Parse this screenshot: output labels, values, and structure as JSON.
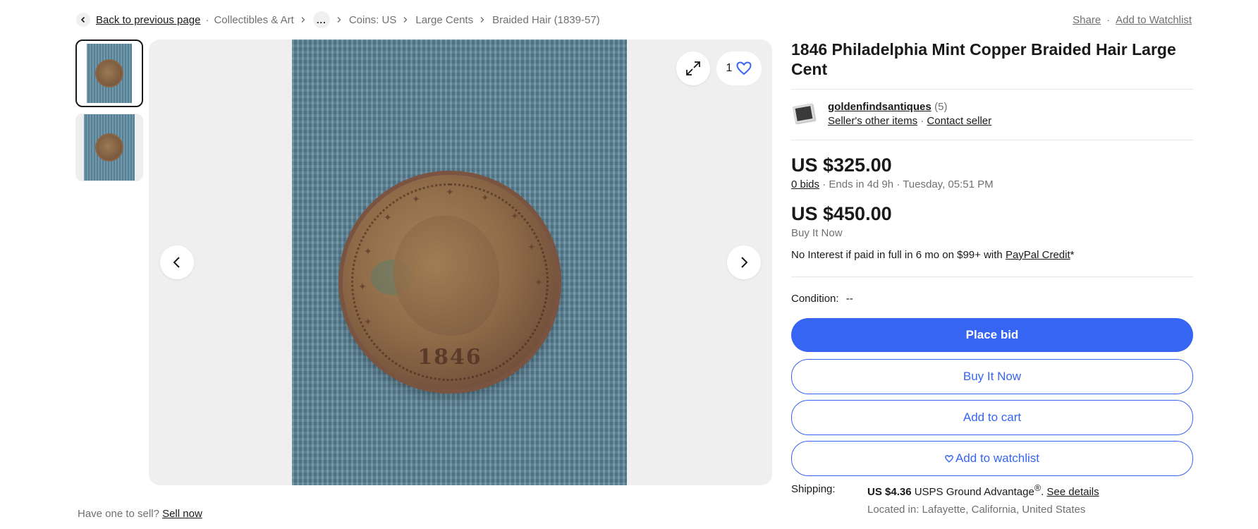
{
  "breadcrumb": {
    "back_label": "Back to previous page",
    "items": [
      "Collectibles & Art",
      "Coins: US",
      "Large Cents",
      "Braided Hair (1839-57)"
    ],
    "more": "..."
  },
  "actions": {
    "share": "Share",
    "watchlist": "Add to Watchlist"
  },
  "gallery": {
    "favorite_count": "1",
    "coin_year": "1846"
  },
  "sell": {
    "prompt": "Have one to sell?",
    "link": "Sell now"
  },
  "listing": {
    "title": "1846 Philadelphia Mint Copper Braided Hair Large Cent",
    "seller": {
      "name": "goldenfindsantiques",
      "feedback": "(5)",
      "other_items": "Seller's other items",
      "contact": "Contact seller"
    },
    "bid": {
      "price": "US $325.00",
      "bids": "0 bids",
      "ends": "Ends in 4d 9h",
      "end_time": "Tuesday, 05:51 PM"
    },
    "buy_now": {
      "price": "US $450.00",
      "label": "Buy It Now"
    },
    "credit": {
      "text": "No Interest if paid in full in 6 mo on $99+ with",
      "link": "PayPal Credit",
      "suffix": "*"
    },
    "condition": {
      "label": "Condition:",
      "value": "--"
    },
    "buttons": {
      "place_bid": "Place bid",
      "buy_it_now": "Buy It Now",
      "add_to_cart": "Add to cart",
      "add_to_watchlist": "Add to watchlist"
    },
    "shipping": {
      "label": "Shipping:",
      "cost": "US $4.36",
      "service": "USPS Ground Advantage",
      "registered": "®",
      "period": ".",
      "details": "See details",
      "location": "Located in: Lafayette, California, United States"
    }
  },
  "colors": {
    "accent": "#3665f3",
    "text": "#191919",
    "muted": "#707070"
  }
}
